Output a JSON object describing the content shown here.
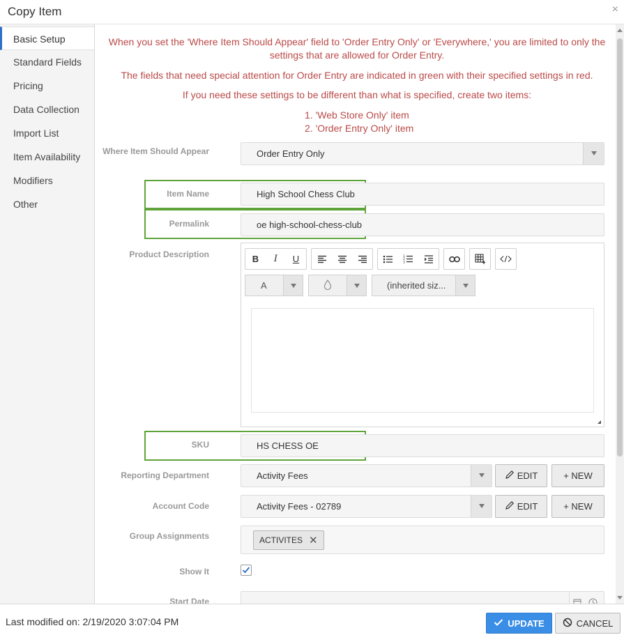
{
  "dialog": {
    "title": "Copy Item",
    "close": "×"
  },
  "sidebar": {
    "items": [
      {
        "label": "Basic Setup"
      },
      {
        "label": "Standard Fields"
      },
      {
        "label": "Pricing"
      },
      {
        "label": "Data Collection"
      },
      {
        "label": "Import List"
      },
      {
        "label": "Item Availability"
      },
      {
        "label": "Modifiers"
      },
      {
        "label": "Other"
      }
    ]
  },
  "notice": {
    "line1": "When you set the 'Where Item Should Appear' field to 'Order Entry Only' or 'Everywhere,' you are limited to only the settings that are allowed for Order Entry.",
    "line2": "The fields that need special attention for Order Entry are indicated in green with their specified settings in red.",
    "line3": "If you need these settings to be different than what is specified, create two items:",
    "list": [
      "1.  'Web Store Only' item",
      "2. 'Order Entry Only' item"
    ]
  },
  "form": {
    "where_label": "Where Item Should Appear",
    "where_value": "Order Entry Only",
    "item_name_label": "Item Name",
    "item_name_value": "High School Chess Club",
    "permalink_label": "Permalink",
    "permalink_value": "oe high-school-chess-club",
    "description_label": "Product Description",
    "editor": {
      "font_color": "A",
      "font_size": "(inherited siz..."
    },
    "sku_label": "SKU",
    "sku_value": "HS CHESS OE",
    "reporting_label": "Reporting Department",
    "reporting_value": "Activity Fees",
    "account_label": "Account Code",
    "account_value": "Activity Fees - 02789",
    "edit_label": "EDIT",
    "new_label": "+ NEW",
    "group_label": "Group Assignments",
    "group_tag": "ACTIVITES",
    "show_label": "Show It",
    "start_label": "Start Date"
  },
  "footer": {
    "last_modified": "Last modified on: 2/19/2020 3:07:04 PM",
    "update_label": "UPDATE",
    "cancel_label": "CANCEL"
  }
}
